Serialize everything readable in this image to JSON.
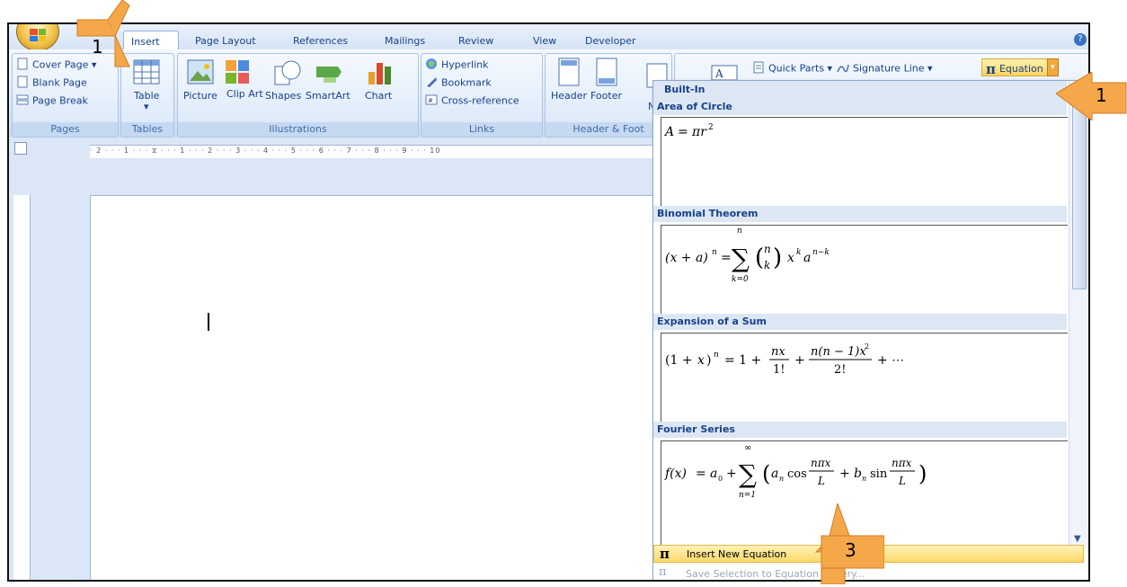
{
  "tabs": [
    "Insert",
    "Page Layout",
    "References",
    "Mailings",
    "Review",
    "View",
    "Developer"
  ],
  "help_glyph": "?",
  "groups": {
    "pages": {
      "label": "Pages",
      "items": [
        "Cover Page",
        "Blank Page",
        "Page Break"
      ]
    },
    "tables": {
      "label": "Tables",
      "item": "Table"
    },
    "illustrations": {
      "label": "Illustrations",
      "items": [
        "Picture",
        "Clip Art",
        "Shapes",
        "SmartArt",
        "Chart"
      ]
    },
    "links": {
      "label": "Links",
      "items": [
        "Hyperlink",
        "Bookmark",
        "Cross-reference"
      ]
    },
    "header_footer": {
      "label": "Header & Foot",
      "items": [
        "Header",
        "Footer",
        "Nu"
      ]
    },
    "text": {
      "quick_parts": "Quick Parts",
      "signature_line": "Signature Line",
      "equation": "Equation"
    }
  },
  "ruler_text": "· 2 · · · 1 · · · ⧖ · · · 1 · · · 2 · · · 3 · · · 4 · · · 5 · · · 6 · · · 7 · · · 8 · · · 9 · · · 10",
  "equation_menu": {
    "header": "Built-In",
    "sections": [
      {
        "title": "Area of Circle"
      },
      {
        "title": "Binomial Theorem"
      },
      {
        "title": "Expansion of a Sum"
      },
      {
        "title": "Fourier Series"
      }
    ],
    "insert_new": "Insert New Equation",
    "save_selection": "Save Selection to Equation Gallery..."
  },
  "callouts": [
    "1",
    "1",
    "3"
  ],
  "colors": {
    "ribbon_text": "#15428b",
    "highlight": "#fbd86a",
    "callout": "#f5a84a"
  }
}
